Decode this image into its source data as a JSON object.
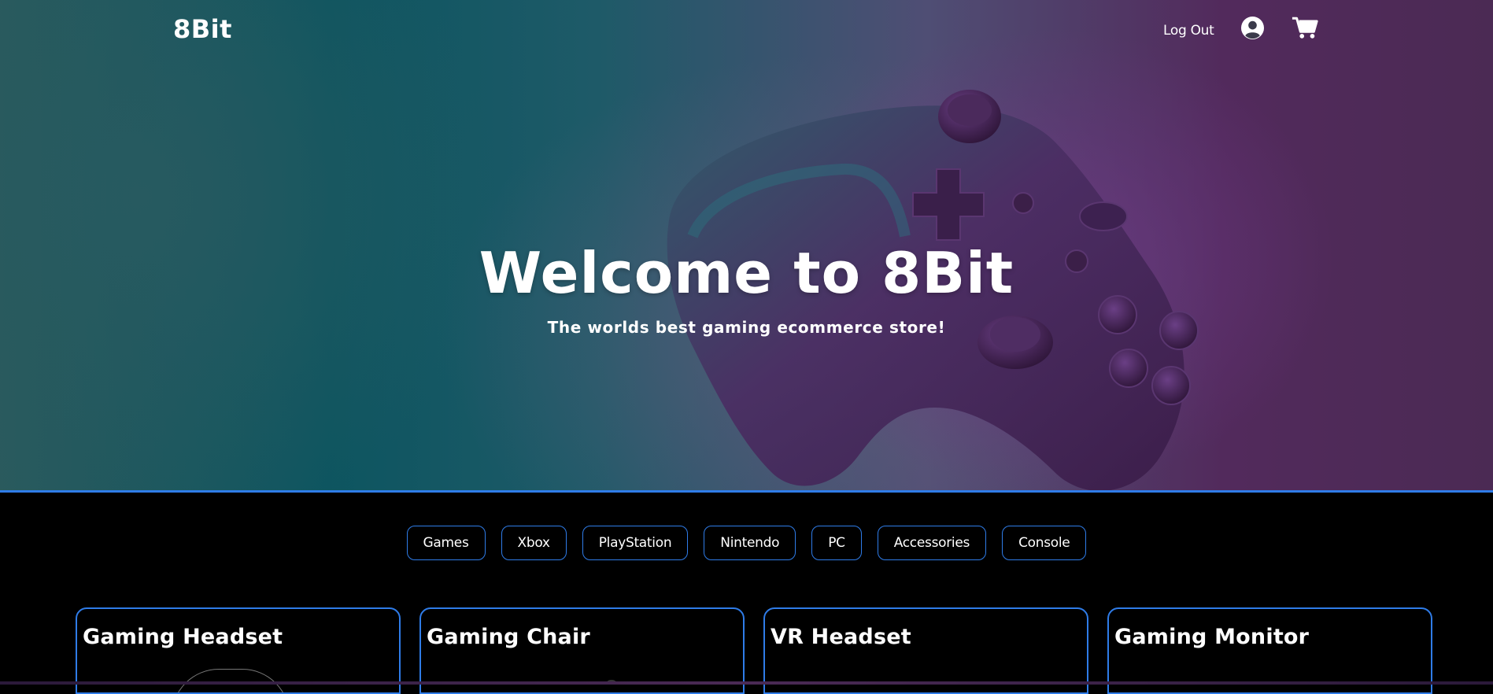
{
  "nav": {
    "logo": "8Bit",
    "logout_label": "Log Out",
    "user_icon": "user-circle-icon",
    "cart_icon": "shopping-cart-icon"
  },
  "hero": {
    "title": "Welcome to 8Bit",
    "subtitle": "The worlds best gaming ecommerce store!"
  },
  "categories": [
    "Games",
    "Xbox",
    "PlayStation",
    "Nintendo",
    "PC",
    "Accessories",
    "Console"
  ],
  "products": [
    {
      "title": "Gaming Headset"
    },
    {
      "title": "Gaming Chair"
    },
    {
      "title": "VR Headset"
    },
    {
      "title": "Gaming Monitor"
    }
  ],
  "colors": {
    "accent": "#2f7ce8",
    "background": "#000000",
    "text": "#ffffff"
  }
}
